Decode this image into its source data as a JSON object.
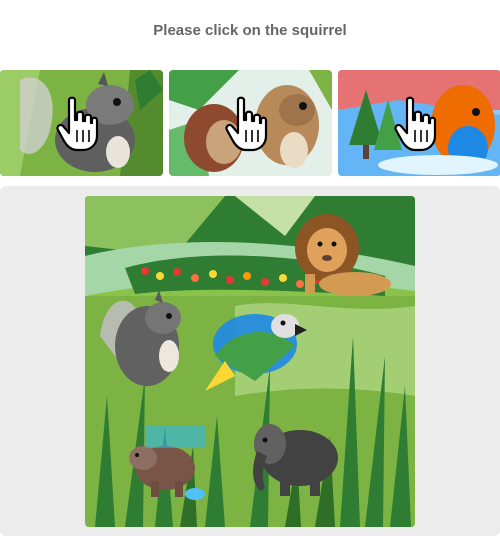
{
  "instruction": "Please click on the squirrel",
  "examples": [
    {
      "subject": "squirrel",
      "cursor_icon": "hand-pointer-icon"
    },
    {
      "subject": "squirrel",
      "cursor_icon": "hand-pointer-icon"
    },
    {
      "subject": "squirrel",
      "cursor_icon": "hand-pointer-icon"
    }
  ],
  "scene": {
    "animals": [
      "lion",
      "squirrel",
      "parrot",
      "bear",
      "elephant"
    ]
  },
  "colors": {
    "title": "#666666",
    "board_bg": "#ececec",
    "leaf_green": "#3e8e3a",
    "leaf_light": "#9ccc65"
  }
}
